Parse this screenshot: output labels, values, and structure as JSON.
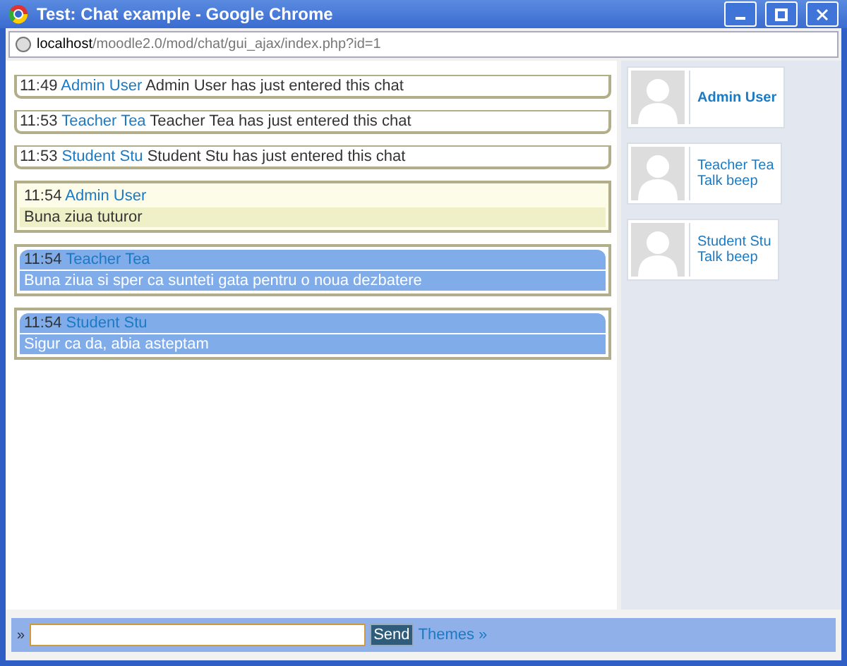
{
  "window": {
    "title": "Test: Chat example - Google Chrome"
  },
  "address": {
    "host": "localhost",
    "path": "/moodle2.0/mod/chat/gui_ajax/index.php?id=1"
  },
  "messages": [
    {
      "kind": "event",
      "time": "11:49",
      "user": "Admin User",
      "text": "Admin User has just entered this chat"
    },
    {
      "kind": "event",
      "time": "11:53",
      "user": "Teacher Tea",
      "text": "Teacher Tea has just entered this chat"
    },
    {
      "kind": "event",
      "time": "11:53",
      "user": "Student Stu",
      "text": "Student Stu has just entered this chat"
    },
    {
      "kind": "own",
      "time": "11:54",
      "user": "Admin User",
      "text": "Buna ziua tuturor"
    },
    {
      "kind": "other",
      "time": "11:54",
      "user": "Teacher Tea",
      "text": "Buna ziua si sper ca sunteti gata pentru o noua dezbatere"
    },
    {
      "kind": "other",
      "time": "11:54",
      "user": "Student Stu",
      "text": "Sigur ca da, abia asteptam"
    }
  ],
  "users": [
    {
      "name": "Admin User",
      "self": true
    },
    {
      "name": "Teacher Tea",
      "self": false,
      "action": "Talk beep"
    },
    {
      "name": "Student Stu",
      "self": false,
      "action": "Talk beep"
    }
  ],
  "input": {
    "prompt": "»",
    "send": "Send",
    "themes": "Themes »"
  }
}
